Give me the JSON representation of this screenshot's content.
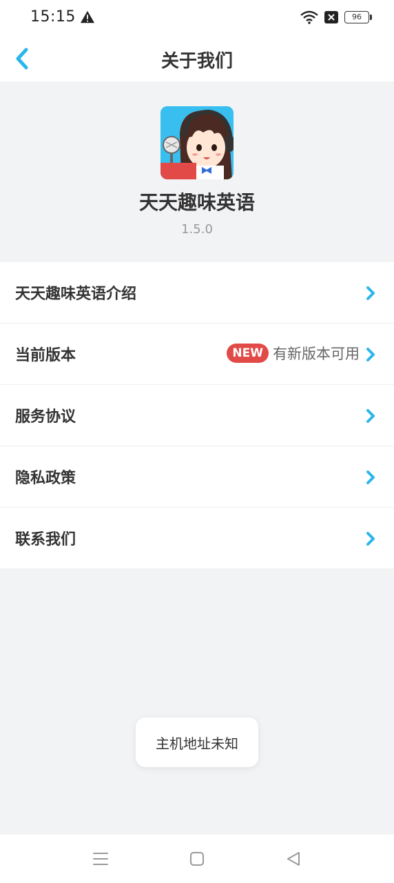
{
  "status_bar": {
    "time": "15:15",
    "battery": "96"
  },
  "nav": {
    "title": "关于我们"
  },
  "app": {
    "name": "天天趣味英语",
    "version": "1.5.0"
  },
  "menu": {
    "intro": "天天趣味英语介绍",
    "current_version": "当前版本",
    "new_badge": "NEW",
    "update_available": "有新版本可用",
    "service": "服务协议",
    "privacy": "隐私政策",
    "contact": "联系我们"
  },
  "toast": {
    "message": "主机地址未知"
  },
  "colors": {
    "accent": "#29b6ea",
    "badge": "#e24a47",
    "background": "#f2f3f5"
  },
  "icons": {
    "back": "chevron-left-icon",
    "chevron": "chevron-right-icon",
    "warning": "warning-icon",
    "wifi": "wifi-icon",
    "battery": "battery-icon"
  }
}
